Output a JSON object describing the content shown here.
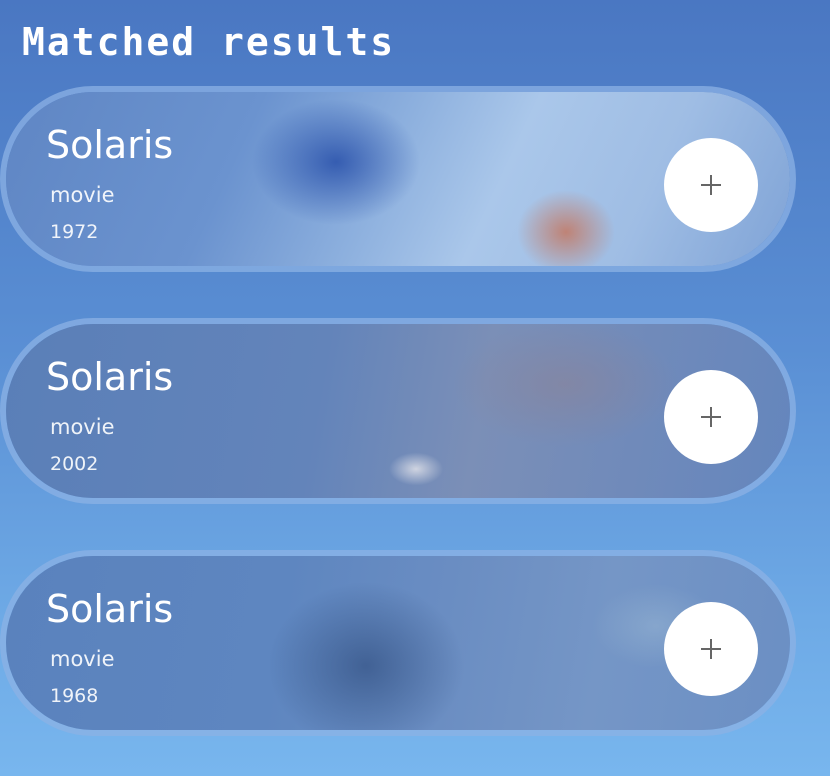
{
  "header": {
    "title": "Matched results"
  },
  "results": [
    {
      "title": "Solaris",
      "type": "movie",
      "year": "1972",
      "action_icon": "plus-icon"
    },
    {
      "title": "Solaris",
      "type": "movie",
      "year": "2002",
      "action_icon": "plus-icon"
    },
    {
      "title": "Solaris",
      "type": "movie",
      "year": "1968",
      "action_icon": "plus-icon"
    }
  ],
  "colors": {
    "background_top": "#4a77c2",
    "background_bottom": "#78b6ee",
    "text": "#ffffff",
    "button_bg": "#ffffff",
    "icon": "#666666"
  }
}
